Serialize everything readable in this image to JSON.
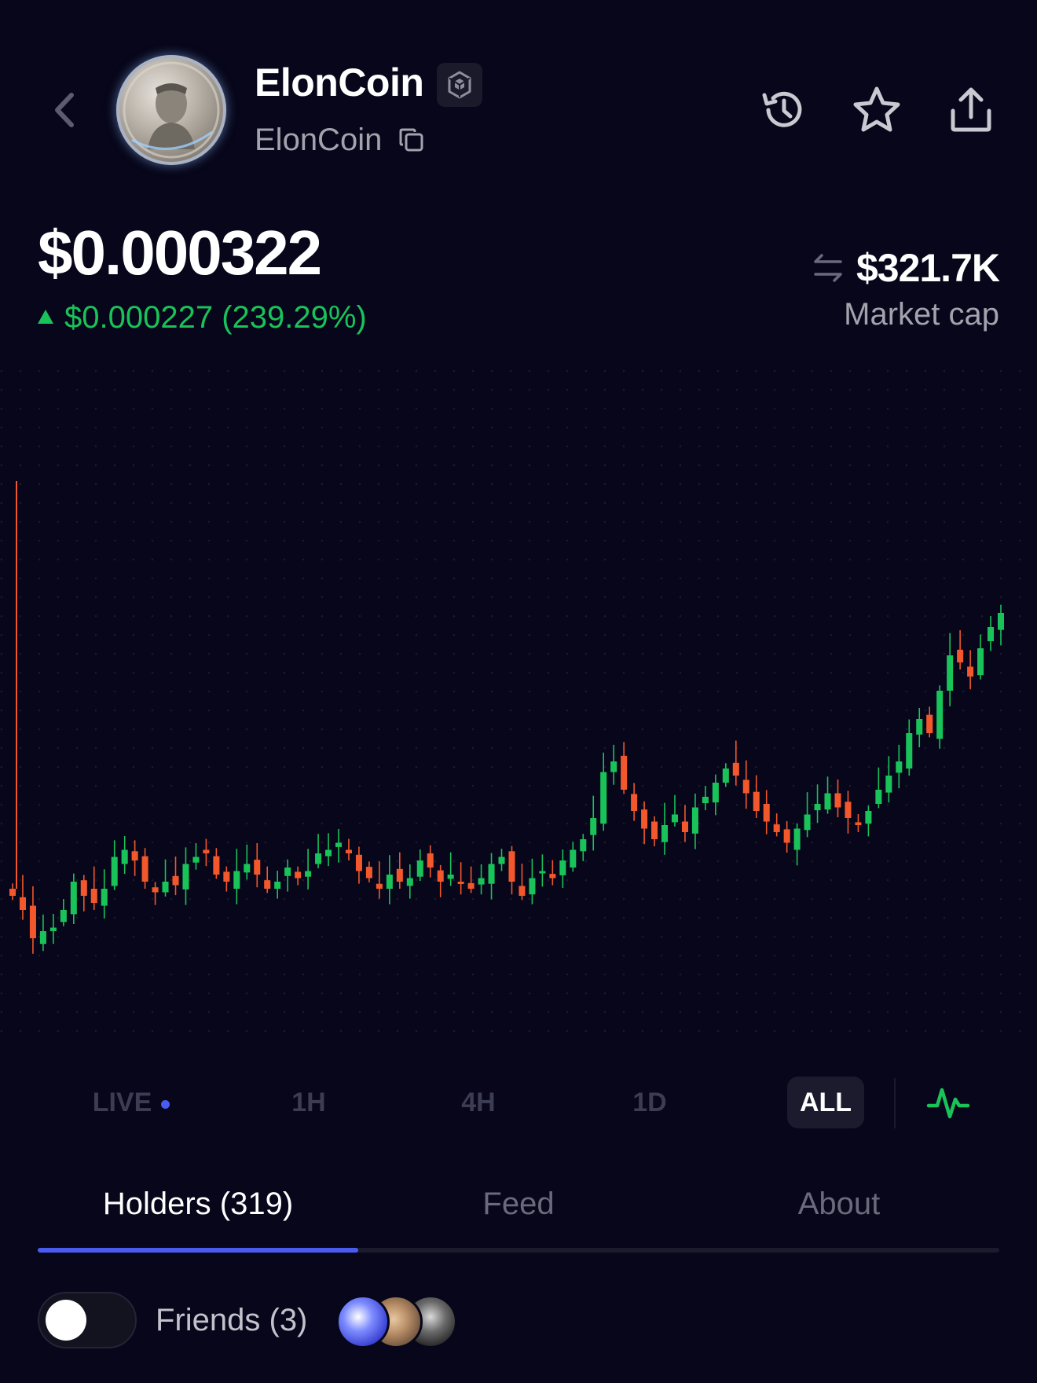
{
  "header": {
    "back_icon": "chevron-left-icon",
    "title": "ElonCoin",
    "subtitle": "ElonCoin",
    "chain_icon": "bnb-chain-icon",
    "copy_icon": "copy-icon",
    "actions": [
      "history-icon",
      "star-icon",
      "share-icon"
    ]
  },
  "price": {
    "current": "$0.000322",
    "change": "$0.000227 (239.29%)",
    "change_color": "#19c35a"
  },
  "market": {
    "value": "$321.7K",
    "label": "Market cap",
    "swap_icon": "swap-arrows-icon"
  },
  "chart_data": {
    "type": "candlestick",
    "up_color": "#19c35a",
    "down_color": "#f2582c",
    "grid": true,
    "relative_price_series": [
      0.2,
      0.16,
      0.08,
      0.1,
      0.11,
      0.16,
      0.24,
      0.2,
      0.18,
      0.22,
      0.31,
      0.33,
      0.3,
      0.24,
      0.21,
      0.24,
      0.23,
      0.29,
      0.31,
      0.32,
      0.26,
      0.24,
      0.27,
      0.29,
      0.26,
      0.22,
      0.24,
      0.28,
      0.25,
      0.27,
      0.32,
      0.33,
      0.35,
      0.32,
      0.27,
      0.25,
      0.22,
      0.26,
      0.24,
      0.25,
      0.3,
      0.28,
      0.24,
      0.26,
      0.24,
      0.22,
      0.25,
      0.29,
      0.31,
      0.24,
      0.2,
      0.25,
      0.27,
      0.25,
      0.3,
      0.33,
      0.36,
      0.42,
      0.55,
      0.58,
      0.5,
      0.44,
      0.39,
      0.36,
      0.4,
      0.43,
      0.38,
      0.45,
      0.48,
      0.52,
      0.56,
      0.54,
      0.49,
      0.44,
      0.41,
      0.38,
      0.35,
      0.39,
      0.43,
      0.46,
      0.49,
      0.45,
      0.42,
      0.4,
      0.44,
      0.5,
      0.54,
      0.58,
      0.66,
      0.7,
      0.66,
      0.78,
      0.88,
      0.86,
      0.82,
      0.9,
      0.96,
      1.0
    ]
  },
  "ranges": [
    {
      "label": "LIVE",
      "active": false
    },
    {
      "label": "1H",
      "active": false
    },
    {
      "label": "4H",
      "active": false
    },
    {
      "label": "1D",
      "active": false
    },
    {
      "label": "ALL",
      "active": true
    }
  ],
  "chart_toggle_icon": "line-chart-icon",
  "tabs": [
    {
      "label": "Holders (319)",
      "active": true
    },
    {
      "label": "Feed",
      "active": false
    },
    {
      "label": "About",
      "active": false
    }
  ],
  "friends": {
    "label": "Friends (3)",
    "toggle_on": false,
    "avatar_count": 3
  }
}
